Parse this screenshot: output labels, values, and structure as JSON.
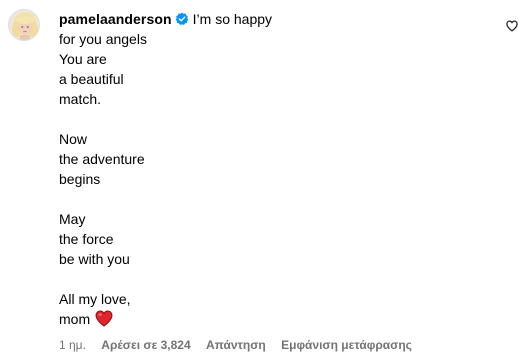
{
  "comment": {
    "avatar_icon": "profile-photo-avatar",
    "username": "pamelaanderson",
    "verified_icon": "verified-badge-icon",
    "verified_color": "#0095f6",
    "first_line": "I’m so happy",
    "lines": [
      "for you angels",
      "You are",
      "a beautiful",
      "match.",
      "",
      "Now",
      "the adventure",
      "begins",
      "",
      "May",
      "the force",
      "be with you",
      "",
      "All my love,",
      "mom"
    ],
    "heart_icon": "red-heart-emoji",
    "heart_color": "#e0242e",
    "like_icon": "heart-outline-icon"
  },
  "meta": {
    "time": "1 ημ.",
    "likes": "Αρέσει σε 3,824",
    "reply": "Απάντηση",
    "translate": "Εμφάνιση μετάφρασης"
  }
}
